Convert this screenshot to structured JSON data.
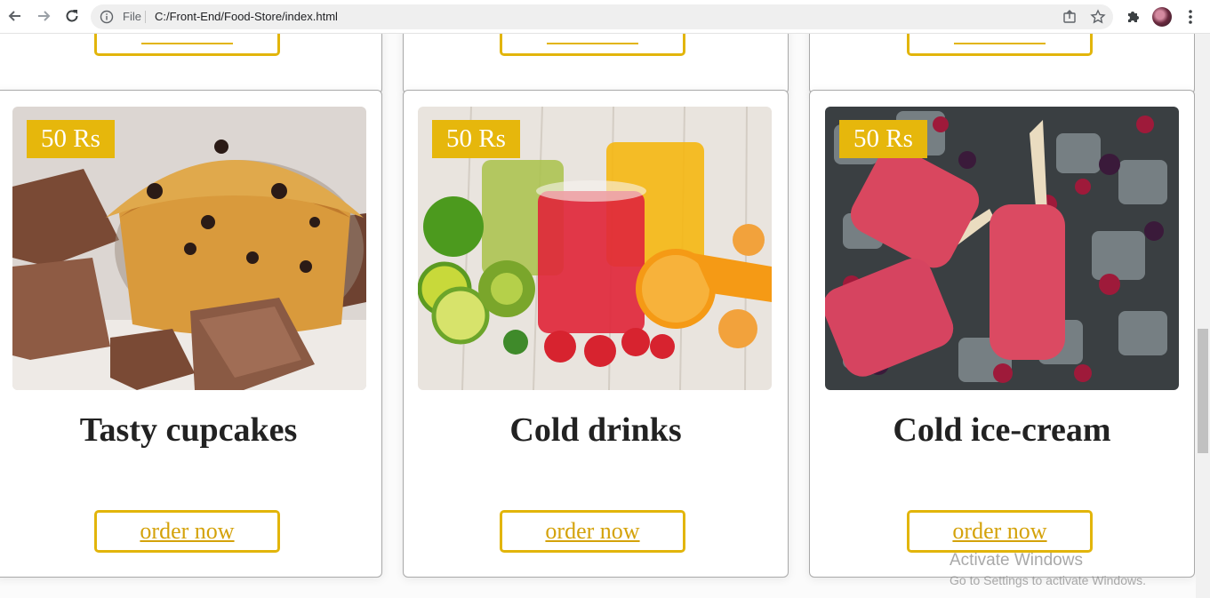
{
  "browser": {
    "scheme_label": "File",
    "url": "C:/Front-End/Food-Store/index.html",
    "icons": [
      "back-arrow-icon",
      "forward-arrow-icon",
      "reload-icon",
      "info-icon",
      "share-icon",
      "star-icon",
      "extensions-puzzle-icon",
      "profile-avatar",
      "kebab-menu-icon"
    ]
  },
  "products": [
    {
      "price": "50 Rs",
      "title": "Tasty cupcakes",
      "button": "order now",
      "image": "muffin-with-chocolate"
    },
    {
      "price": "50 Rs",
      "title": "Cold drinks",
      "button": "order now",
      "image": "juices-and-fruits"
    },
    {
      "price": "50 Rs",
      "title": "Cold ice-cream",
      "button": "order now",
      "image": "berry-popsicles-on-ice"
    }
  ],
  "watermark": {
    "title": "Activate Windows",
    "subtitle": "Go to Settings to activate Windows."
  },
  "colors": {
    "accent": "#e6b70c",
    "button_text": "#d4a20a",
    "title_text": "#222222"
  }
}
